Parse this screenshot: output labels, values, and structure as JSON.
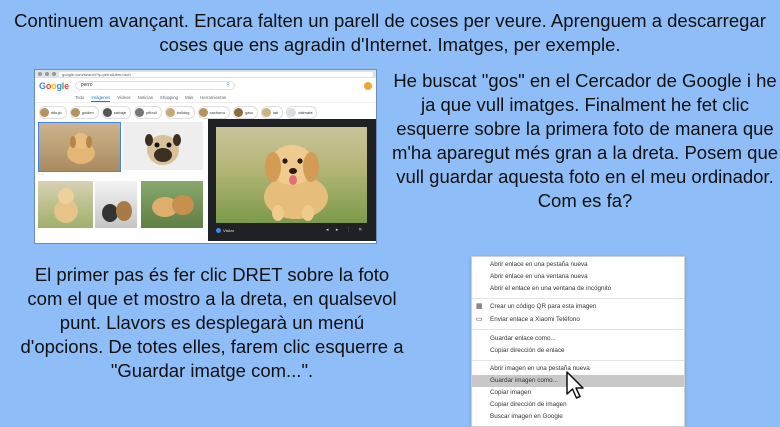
{
  "intro_text": "Continuem avançant. Encara falten un parell de coses per veure. Aprenguem a descarregar coses que ens agradin d'Internet. Imatges, per exemple.",
  "right_text": "He buscat \"gos\" en el Cercador de Google i he ja que vull imatges. Finalment he fet clic esquerre sobre la primera foto de manera que m'ha aparegut més gran a la dreta. Posem que vull guardar aquesta foto en el meu ordinador. Com es fa?",
  "left_text": "El primer pas és fer clic DRET sobre la foto com el que et mostro a la dreta, en qualsevol punt. Llavors es desplegarà un menú d'opcions. De totes elles, farem clic esquerre a \"Guardar imatge com...\".",
  "google": {
    "url": "google.com/search?q=perro&tbm=isch",
    "logo": [
      "G",
      "o",
      "o",
      "g",
      "l",
      "e"
    ],
    "query": "perro",
    "tabs": [
      "Todo",
      "Imágenes",
      "Vídeos",
      "Noticias",
      "Shopping",
      "Más",
      "Herramientas"
    ],
    "active_tab": "Imágenes",
    "chips": [
      "dibujo",
      "golden",
      "salvaje",
      "pitbull",
      "bulldog",
      "cachorro",
      "gato",
      "lab",
      "dálmata",
      "dibujos"
    ],
    "visit_label": "Visitar"
  },
  "menu": {
    "items": [
      "Abrir enlace en una pestaña nueva",
      "Abrir enlace en una ventana nueva",
      "Abrir el enlace en una ventana de incógnito",
      "Crear un código QR para esta imagen",
      "Enviar enlace a Xiaomi Teléfono",
      "Guardar enlace como...",
      "Copiar dirección de enlace",
      "Abrir imagen en una pestaña nueva",
      "Guardar imagen como...",
      "Copiar imagen",
      "Copiar dirección de imagen",
      "Buscar imagen en Google"
    ],
    "highlighted": "Guardar imagen como..."
  },
  "colors": {
    "background": "#8fbdf7",
    "highlight": "#c8c8c8"
  }
}
